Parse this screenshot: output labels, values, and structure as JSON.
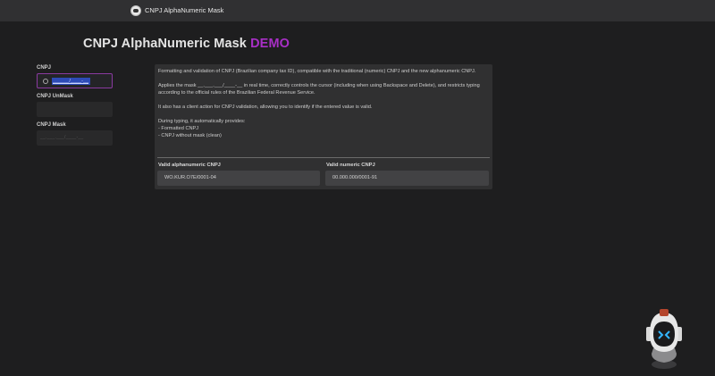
{
  "app": {
    "title": "CNPJ AlphaNumeric Mask"
  },
  "page": {
    "title_main": "CNPJ AlphaNumeric Mask",
    "title_demo": "DEMO"
  },
  "fields": {
    "cnpj_label": "CNPJ",
    "cnpj_value": "______/____-__",
    "unmask_label": "CNPJ UnMask",
    "mask_label": "CNPJ Mask",
    "mask_placeholder": "__.___.___/____-__"
  },
  "info": {
    "p1": "Formatting and validation of CNPJ (Brazilian company tax ID), compatible with the traditional (numeric) CNPJ and the new alphanumeric CNPJ.",
    "p2": "Applies the mask __.___.___/____-__ in real time, correctly controls the cursor (including when using Backspace and Delete), and restricts typing according to the official rules of the Brazilian Federal Revenue Service.",
    "p3": "It also has a client action for CNPJ validation, allowing you to identify if the entered value is valid.",
    "p4_title": "During typing, it automatically provides:",
    "p4_item1": "- Formatted CNPJ",
    "p4_item2": "- CNPJ without mask (clean)"
  },
  "examples": {
    "alpha_label": "Valid alphanumeric CNPJ",
    "alpha_value": "WO.KUR.O7E/0001-04",
    "numeric_label": "Valid numeric CNPJ",
    "numeric_value": "00.000.000/0001-91"
  },
  "colors": {
    "accent": "#a82fc6",
    "background": "#1e1e1f",
    "topbar": "#303032",
    "panel": "#303031"
  }
}
